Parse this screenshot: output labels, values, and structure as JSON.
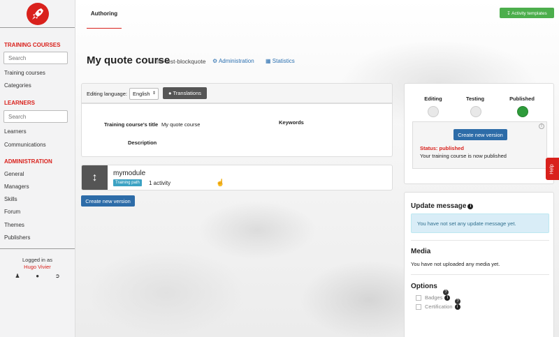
{
  "sidebar": {
    "sections": {
      "training": "TRAINING COURSES",
      "learners": "LEARNERS",
      "administration": "ADMINISTRATION"
    },
    "search_placeholder_1": "Search",
    "search_placeholder_2": "Search",
    "training_items": [
      "Training courses",
      "Categories"
    ],
    "learner_items": [
      "Learners",
      "Communications"
    ],
    "admin_items": [
      "General",
      "Managers",
      "Skills",
      "Forum",
      "Themes",
      "Publishers"
    ],
    "logged_in_as": "Logged in as",
    "user_name": "Hugo Vivier"
  },
  "header": {
    "tab_authoring": "Authoring",
    "activity_templates": "Activity templates"
  },
  "course": {
    "title": "My quote course",
    "code": "hv-test-blockquote",
    "administration_link": "Administration",
    "statistics_link": "Statistics"
  },
  "editing": {
    "language_label": "Editing language:",
    "language_value": "English",
    "translations_button": "Translations"
  },
  "course_info": {
    "title_label": "Training course's title",
    "title_value": "My quote course",
    "description_label": "Description",
    "keywords_label": "Keywords"
  },
  "module": {
    "name": "mymodule",
    "badge": "Training path",
    "activity_count": "1 activity"
  },
  "create_version_label": "Create new version",
  "publishing": {
    "stages": [
      "Editing",
      "Testing",
      "Published"
    ],
    "active_stage": "Published",
    "create_version_label": "Create new version",
    "status_label": "Status: published",
    "status_text": "Your training course is now published",
    "colors": {
      "active": "#2e9b3b",
      "inactive": "#e8e8e8"
    }
  },
  "help_label": "Help",
  "update_message": {
    "title": "Update message",
    "text": "You have not set any update message yet."
  },
  "media": {
    "title": "Media",
    "text": "You have not uploaded any media yet."
  },
  "options": {
    "title": "Options",
    "items": [
      "Badges",
      "Certification"
    ],
    "help_glyph": "?"
  },
  "theme": {
    "accent": "#d9211c",
    "primary": "#2d6ca8",
    "success": "#4cae4c"
  }
}
